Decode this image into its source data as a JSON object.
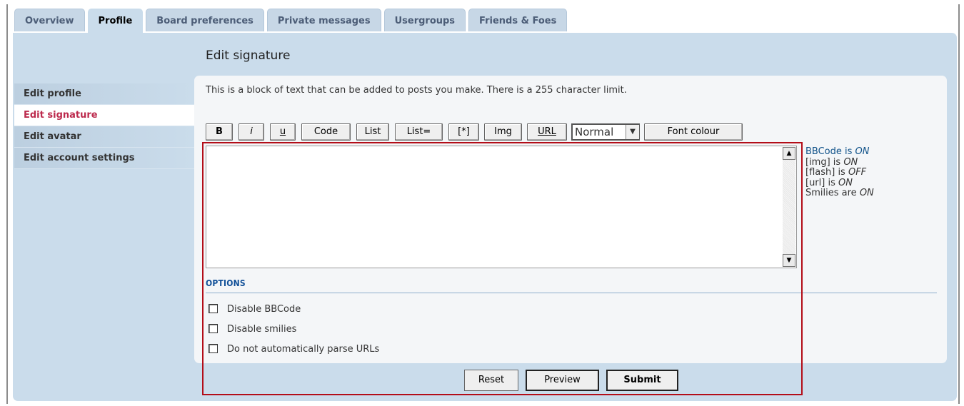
{
  "tabs": [
    "Overview",
    "Profile",
    "Board preferences",
    "Private messages",
    "Usergroups",
    "Friends & Foes"
  ],
  "active_tab": "Profile",
  "page_title": "Edit signature",
  "sidebar": {
    "items": [
      {
        "label": "Edit profile"
      },
      {
        "label": "Edit signature"
      },
      {
        "label": "Edit avatar"
      },
      {
        "label": "Edit account settings"
      }
    ]
  },
  "intro_text": "This is a block of text that can be added to posts you make. There is a 255 character limit.",
  "toolbar": {
    "bold": "B",
    "italic": "i",
    "underline": "u",
    "code": "Code",
    "list": "List",
    "list_eq": "List=",
    "list_item": "[*]",
    "img": "Img",
    "url": "URL",
    "size_value": "Normal",
    "font_colour": "Font colour"
  },
  "signature": {
    "value": ""
  },
  "status": {
    "bbcode_label": "BBCode is ",
    "bbcode_value": "ON",
    "img_label": "[img] is ",
    "img_value": "ON",
    "flash_label": "[flash] is ",
    "flash_value": "OFF",
    "url_label": "[url] is ",
    "url_value": "ON",
    "smilies_label": "Smilies are ",
    "smilies_value": "ON"
  },
  "options": {
    "heading": "OPTIONS",
    "disable_bbcode": "Disable BBCode",
    "disable_smilies": "Disable smilies",
    "no_parse_urls": "Do not automatically parse URLs"
  },
  "actions": {
    "reset": "Reset",
    "preview": "Preview",
    "submit": "Submit"
  },
  "colors": {
    "panel": "#cadceb",
    "active_nav": "#bc2a4d",
    "options_heading": "#115098",
    "highlight": "#b30d18"
  }
}
